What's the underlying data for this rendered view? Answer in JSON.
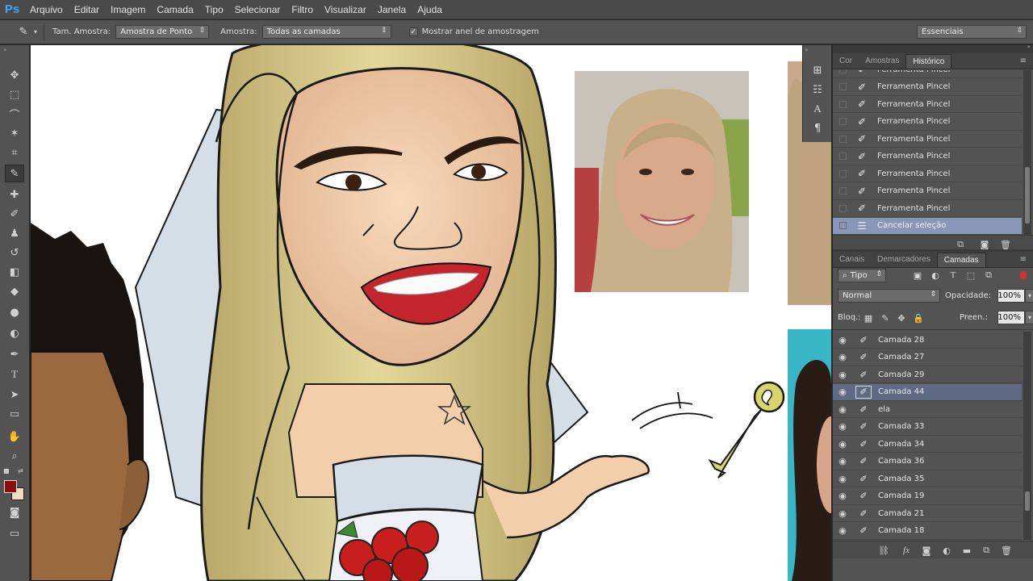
{
  "app": {
    "logo": "Ps",
    "menu": [
      "Arquivo",
      "Editar",
      "Imagem",
      "Camada",
      "Tipo",
      "Selecionar",
      "Filtro",
      "Visualizar",
      "Janela",
      "Ajuda"
    ]
  },
  "options": {
    "sample_size_label": "Tam. Amostra:",
    "sample_size_value": "Amostra de Ponto",
    "sample_label": "Amostra:",
    "sample_value": "Todas as camadas",
    "show_ring_label": "Mostrar anel de amostragem",
    "show_ring_checked": true,
    "workspace": "Essenciais"
  },
  "toolbar": {
    "foreground_color": "#8b0d0d",
    "background_color": "#f2dcc4"
  },
  "history_panel": {
    "tabs": [
      "Cor",
      "Amostras",
      "Histórico"
    ],
    "active_tab": "Histórico",
    "items": [
      "Ferramenta Pincel",
      "Ferramenta Pincel",
      "Ferramenta Pincel",
      "Ferramenta Pincel",
      "Ferramenta Pincel",
      "Ferramenta Pincel",
      "Ferramenta Pincel",
      "Ferramenta Pincel",
      "Ferramenta Pincel",
      "Cancelar seleção"
    ],
    "selected_index": 9
  },
  "layers_panel": {
    "tabs": [
      "Canais",
      "Demarcadores",
      "Camadas"
    ],
    "active_tab": "Camadas",
    "filter_kind": "Tipo",
    "blend_mode": "Normal",
    "opacity_label": "Opacidade:",
    "opacity_value": "100%",
    "lock_label": "Bloq.:",
    "fill_label": "Preen.:",
    "fill_value": "100%",
    "layers": [
      "Camada 28",
      "Camada 27",
      "Camada 29",
      "Camada 44",
      "ela",
      "Camada 33",
      "Camada 34",
      "Camada 36",
      "Camada 35",
      "Camada 19",
      "Camada 21",
      "Camada 18"
    ],
    "selected_index": 3
  },
  "colors": {
    "accent_selected_history": "#8a96b8",
    "accent_selected_layer": "#5f6a85",
    "ps_logo": "#3ea6ff"
  }
}
